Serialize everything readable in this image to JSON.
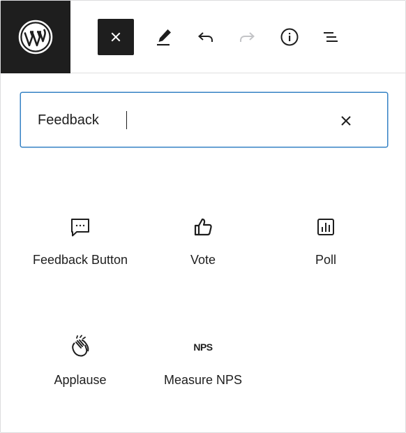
{
  "toolbar": {
    "logo": "wordpress-logo",
    "buttons": [
      {
        "icon": "close-icon"
      },
      {
        "icon": "pencil-icon"
      },
      {
        "icon": "undo-icon"
      },
      {
        "icon": "redo-icon"
      },
      {
        "icon": "info-icon"
      },
      {
        "icon": "list-view-icon"
      }
    ]
  },
  "search": {
    "value": "Feedback",
    "clear_icon": "close-icon"
  },
  "results": [
    {
      "label": "Feedback Button",
      "icon": "feedback-bubble-icon"
    },
    {
      "label": "Vote",
      "icon": "thumbs-up-icon"
    },
    {
      "label": "Poll",
      "icon": "poll-chart-icon"
    },
    {
      "label": "Applause",
      "icon": "applause-icon"
    },
    {
      "label": "Measure NPS",
      "icon": "nps-icon",
      "icon_text": "NPS"
    }
  ],
  "colors": {
    "dark": "#1e1e1e",
    "focus": "#3582c4",
    "disabled": "#c3c4c7"
  }
}
